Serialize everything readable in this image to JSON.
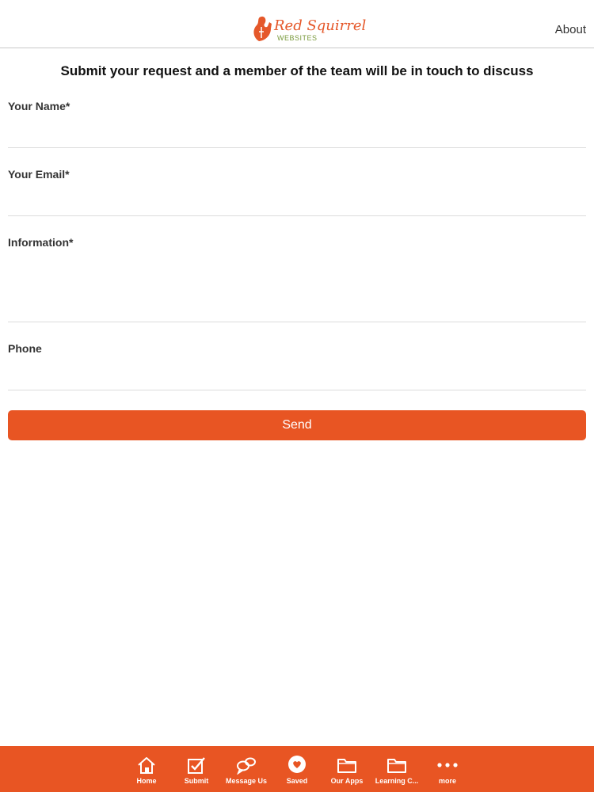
{
  "header": {
    "logo_line1": "Red Squirrel",
    "logo_line2": "WEBSITES",
    "about_label": "About"
  },
  "form": {
    "heading": "Submit your request and a member of the team will be in touch to discuss",
    "fields": [
      {
        "label": "Your Name*",
        "value": ""
      },
      {
        "label": "Your Email*",
        "value": ""
      },
      {
        "label": "Information*",
        "value": ""
      },
      {
        "label": "Phone",
        "value": ""
      }
    ],
    "send_label": "Send"
  },
  "tabbar": {
    "tabs": [
      {
        "label": "Home",
        "icon": "home-icon"
      },
      {
        "label": "Submit",
        "icon": "checkbox-icon"
      },
      {
        "label": "Message Us",
        "icon": "chat-bubbles-icon"
      },
      {
        "label": "Saved",
        "icon": "heart-icon"
      },
      {
        "label": "Our Apps",
        "icon": "folder-icon"
      },
      {
        "label": "Learning C...",
        "icon": "folder-icon"
      },
      {
        "label": "more",
        "icon": "more-dots-icon"
      }
    ]
  },
  "colors": {
    "accent": "#e85523",
    "logo_green": "#7a9a3c",
    "divider": "#dcdcdc"
  }
}
